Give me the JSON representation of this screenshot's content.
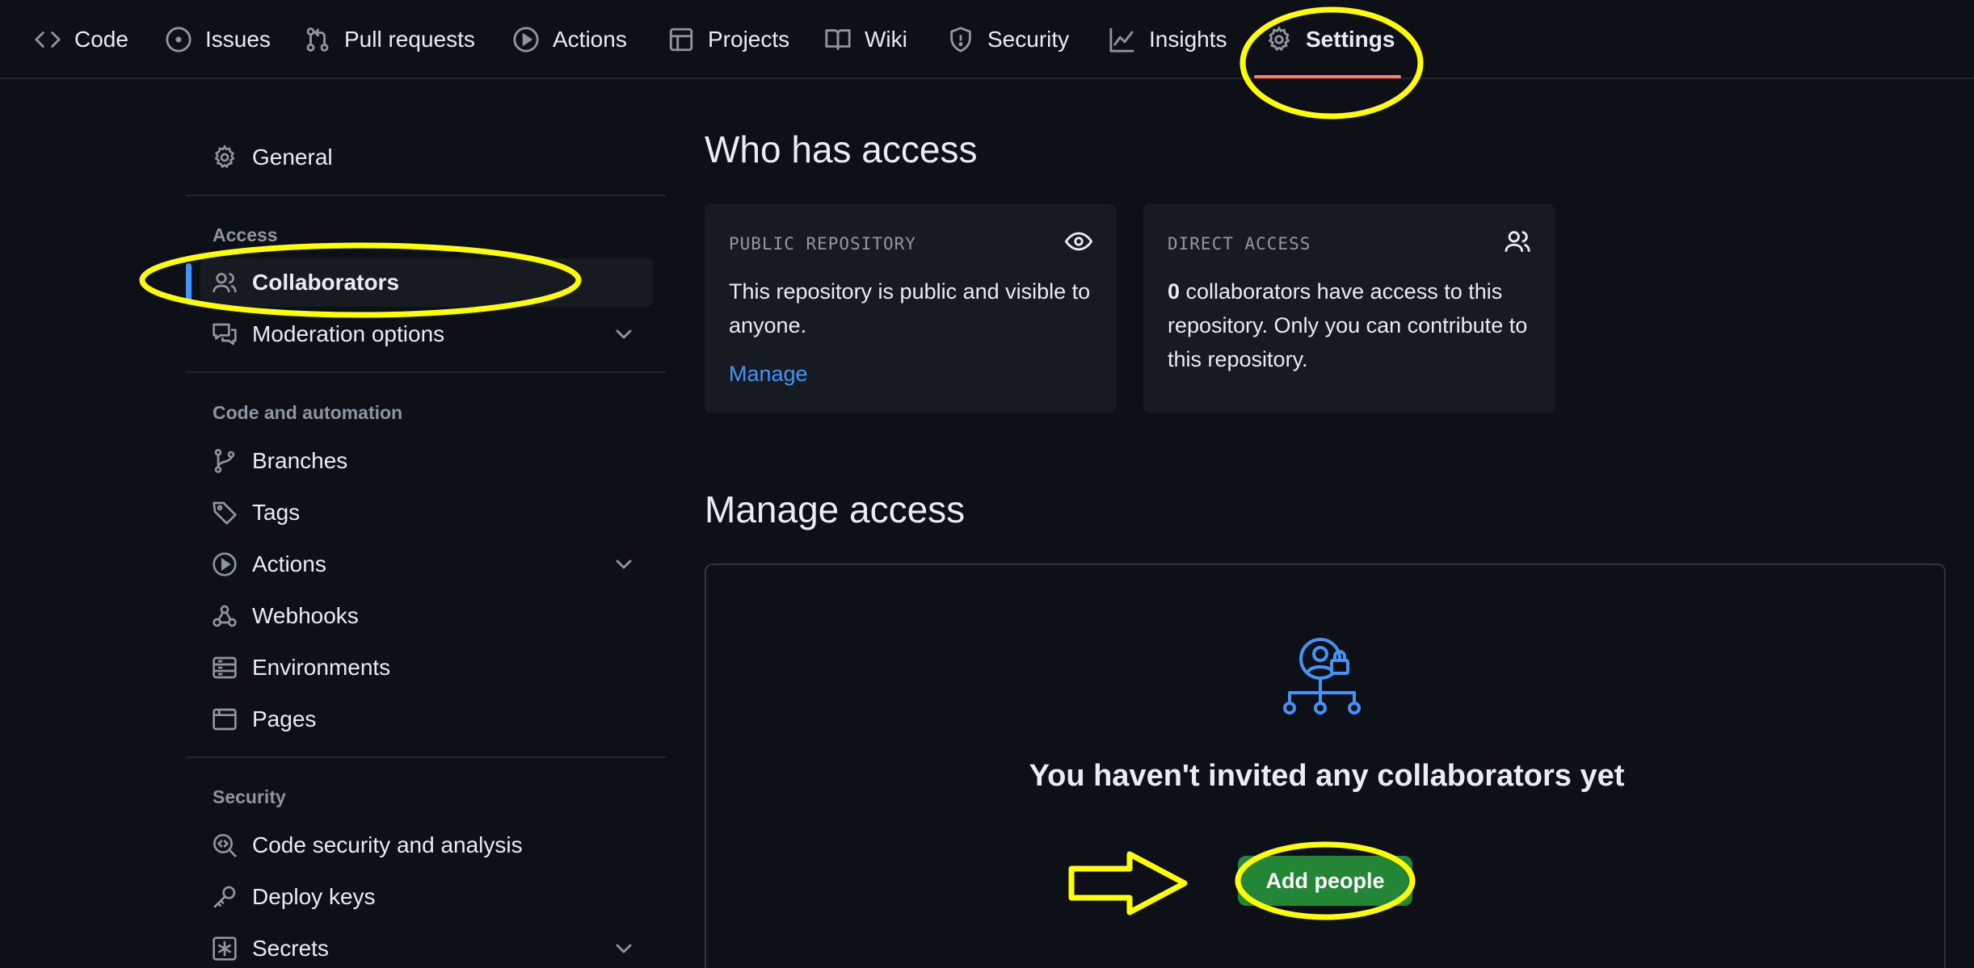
{
  "topnav": {
    "tabs": [
      {
        "label": "Code",
        "icon": "code-icon"
      },
      {
        "label": "Issues",
        "icon": "issue-opened-icon"
      },
      {
        "label": "Pull requests",
        "icon": "git-pull-request-icon"
      },
      {
        "label": "Actions",
        "icon": "play-icon"
      },
      {
        "label": "Projects",
        "icon": "table-icon"
      },
      {
        "label": "Wiki",
        "icon": "book-icon"
      },
      {
        "label": "Security",
        "icon": "shield-icon"
      },
      {
        "label": "Insights",
        "icon": "graph-icon"
      },
      {
        "label": "Settings",
        "icon": "gear-icon",
        "active": true
      }
    ]
  },
  "sidebar": {
    "general": "General",
    "access_heading": "Access",
    "collaborators": "Collaborators",
    "moderation": "Moderation options",
    "code_heading": "Code and automation",
    "branches": "Branches",
    "tags": "Tags",
    "actions": "Actions",
    "webhooks": "Webhooks",
    "environments": "Environments",
    "pages": "Pages",
    "security_heading": "Security",
    "code_security": "Code security and analysis",
    "deploy_keys": "Deploy keys",
    "secrets": "Secrets"
  },
  "main": {
    "who_title": "Who has access",
    "public_card": {
      "title": "PUBLIC REPOSITORY",
      "text": "This repository is public and visible to anyone.",
      "link": "Manage"
    },
    "direct_card": {
      "title": "DIRECT ACCESS",
      "count": "0",
      "text": " collaborators have access to this repository. Only you can contribute to this repository."
    },
    "manage_title": "Manage access",
    "empty_title": "You haven't invited any collaborators yet",
    "add_button": "Add people"
  },
  "colors": {
    "background": "#0d1117",
    "accent_blue": "#4493f8",
    "active_tab_underline": "#f78166",
    "button_green": "#238636",
    "annotation_yellow": "#ffff00"
  }
}
